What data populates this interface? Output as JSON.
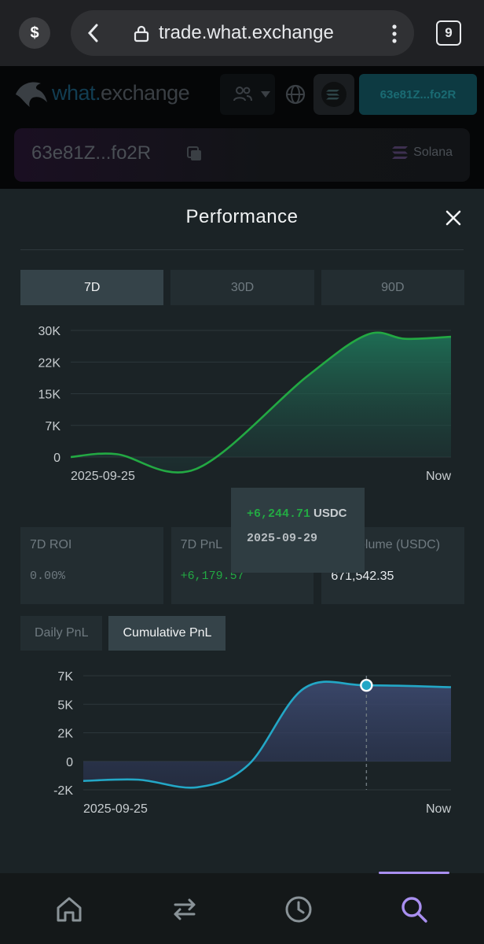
{
  "browser": {
    "url": "trade.what.exchange",
    "tab_count": "9",
    "dollar_icon": "$"
  },
  "header": {
    "logo_word1": "what.",
    "logo_word2": "exchange",
    "wallet_label": "63e81Z...fo2R"
  },
  "account": {
    "address": "63e81Z...fo2R",
    "chain": "Solana"
  },
  "sheet": {
    "title": "Performance",
    "range_tabs": [
      {
        "label": "7D",
        "active": true
      },
      {
        "label": "30D",
        "active": false
      },
      {
        "label": "90D",
        "active": false
      }
    ]
  },
  "stats": [
    {
      "label": "7D ROI",
      "value": "0.00%"
    },
    {
      "label": "7D PnL",
      "value": "+6,179.57"
    },
    {
      "label": "7D Volume (USDC)",
      "value": "671,542.35"
    }
  ],
  "pnl_tabs": [
    {
      "label": "Daily PnL",
      "active": false
    },
    {
      "label": "Cumulative PnL",
      "active": true
    }
  ],
  "tooltip": {
    "value": "+6,244.71",
    "unit": "USDC",
    "date": "2025-09-29"
  },
  "colors": {
    "positive": "#23a943",
    "line1": "#23a943",
    "line2": "#23a7c6",
    "nav_active": "#a98ff0"
  },
  "nav_icons": [
    "home-icon",
    "swap-icon",
    "history-icon",
    "search-icon"
  ],
  "chart_data": [
    {
      "type": "area",
      "title": "",
      "x_labels": [
        "2025-09-25",
        "Now"
      ],
      "y_ticks": [
        "30K",
        "22K",
        "15K",
        "7K",
        "0"
      ],
      "ylim": [
        0,
        30000
      ],
      "series": [
        {
          "x": [
            0,
            0.12,
            0.33,
            0.62,
            0.78,
            0.88,
            1.0
          ],
          "values": [
            0,
            700,
            -2800,
            19000,
            29000,
            28000,
            28500
          ]
        }
      ]
    },
    {
      "type": "area",
      "title": "",
      "x_labels": [
        "2025-09-25",
        "Now"
      ],
      "y_ticks": [
        "7K",
        "5K",
        "2K",
        "0",
        "-2K"
      ],
      "ylim": [
        -2000,
        7000
      ],
      "series": [
        {
          "x": [
            0,
            0.15,
            0.31,
            0.45,
            0.6,
            0.77,
            1.0
          ],
          "values": [
            -1300,
            -1200,
            -1800,
            0,
            6000,
            6244.71,
            6100
          ]
        }
      ]
    }
  ]
}
